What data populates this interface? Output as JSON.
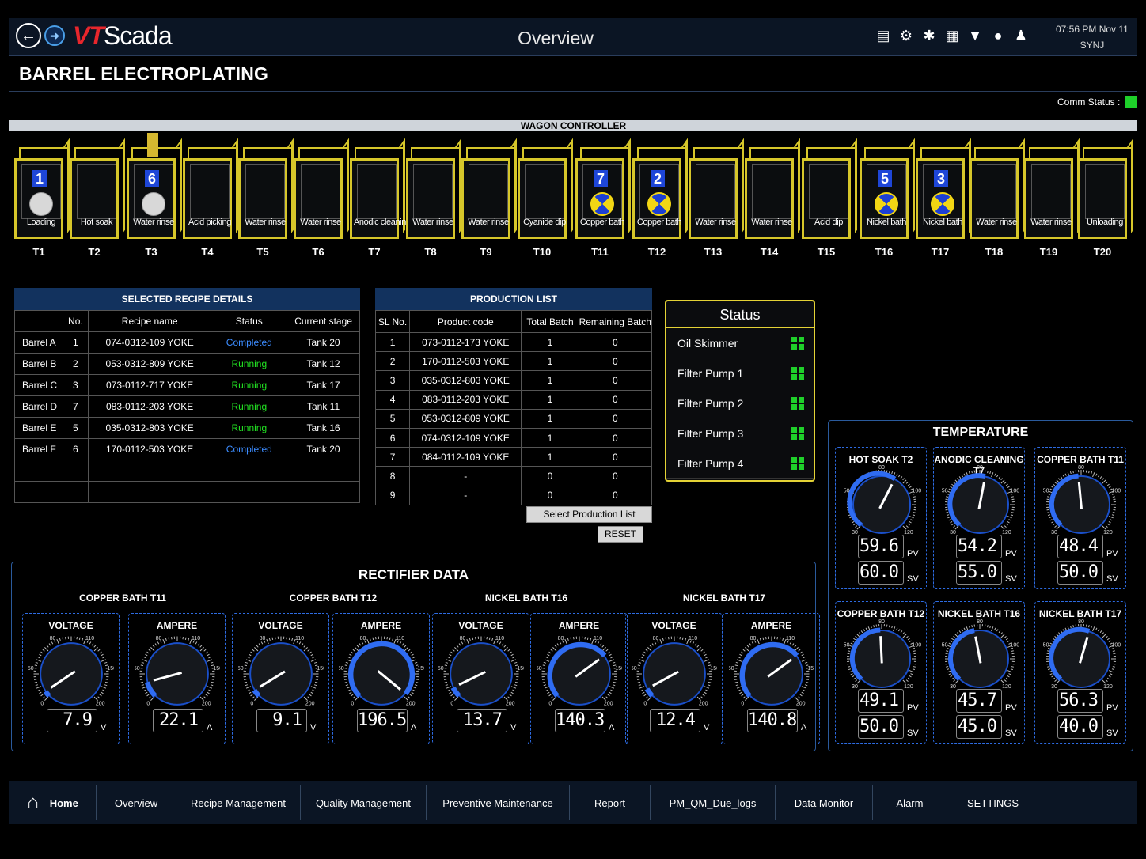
{
  "topbar": {
    "logo_vt": "VT",
    "logo_rest": "Scada",
    "title": "Overview",
    "time": "07:56 PM  Nov 11",
    "user": "SYNJ",
    "icons": [
      "trend-icon",
      "gear-icon",
      "maintenance-icon",
      "calendar-icon",
      "filter-icon",
      "help-icon",
      "user-icon"
    ]
  },
  "page_heading": "BARREL ELECTROPLATING",
  "comm_status_label": "Comm Status :",
  "wagon_controller_label": "WAGON CONTROLLER",
  "tanks": [
    {
      "id": "T1",
      "label": "Loading",
      "barrel": "1",
      "content": "white"
    },
    {
      "id": "T2",
      "label": "Hot soak",
      "barrel": "",
      "content": ""
    },
    {
      "id": "T3",
      "label": "Water rinse",
      "barrel": "6",
      "content": "white",
      "hoist": true
    },
    {
      "id": "T4",
      "label": "Acid picking",
      "barrel": "",
      "content": ""
    },
    {
      "id": "T5",
      "label": "Water rinse",
      "barrel": "",
      "content": ""
    },
    {
      "id": "T6",
      "label": "Water rinse",
      "barrel": "",
      "content": ""
    },
    {
      "id": "T7",
      "label": "Anodic cleaning",
      "barrel": "",
      "content": ""
    },
    {
      "id": "T8",
      "label": "Water rinse",
      "barrel": "",
      "content": ""
    },
    {
      "id": "T9",
      "label": "Water rinse",
      "barrel": "",
      "content": ""
    },
    {
      "id": "T10",
      "label": "Cyanide dip",
      "barrel": "",
      "content": ""
    },
    {
      "id": "T11",
      "label": "Copper bath",
      "barrel": "7",
      "content": "radial"
    },
    {
      "id": "T12",
      "label": "Copper bath",
      "barrel": "2",
      "content": "radial"
    },
    {
      "id": "T13",
      "label": "Water rinse",
      "barrel": "",
      "content": ""
    },
    {
      "id": "T14",
      "label": "Water rinse",
      "barrel": "",
      "content": ""
    },
    {
      "id": "T15",
      "label": "Acid dip",
      "barrel": "",
      "content": ""
    },
    {
      "id": "T16",
      "label": "Nickel bath",
      "barrel": "5",
      "content": "radial"
    },
    {
      "id": "T17",
      "label": "Nickel bath",
      "barrel": "3",
      "content": "radial"
    },
    {
      "id": "T18",
      "label": "Water rinse",
      "barrel": "",
      "content": ""
    },
    {
      "id": "T19",
      "label": "Water rinse",
      "barrel": "",
      "content": ""
    },
    {
      "id": "T20",
      "label": "Unloading",
      "barrel": "",
      "content": ""
    }
  ],
  "recipe": {
    "title": "SELECTED RECIPE DETAILS",
    "headers": [
      "",
      "No.",
      "Recipe name",
      "Status",
      "Current stage"
    ],
    "rows": [
      [
        "Barrel A",
        "1",
        "074-0312-109 YOKE",
        "Completed",
        "Tank 20"
      ],
      [
        "Barrel B",
        "2",
        "053-0312-809 YOKE",
        "Running",
        "Tank 12"
      ],
      [
        "Barrel C",
        "3",
        "073-0112-717 YOKE",
        "Running",
        "Tank 17"
      ],
      [
        "Barrel D",
        "7",
        "083-0112-203 YOKE",
        "Running",
        "Tank 11"
      ],
      [
        "Barrel E",
        "5",
        "035-0312-803 YOKE",
        "Running",
        "Tank 16"
      ],
      [
        "Barrel F",
        "6",
        "170-0112-503 YOKE",
        "Completed",
        "Tank 20"
      ],
      [
        "",
        "",
        "",
        "",
        ""
      ],
      [
        "",
        "",
        "",
        "",
        ""
      ]
    ]
  },
  "production": {
    "title": "PRODUCTION LIST",
    "headers": [
      "SL No.",
      "Product code",
      "Total Batch",
      "Remaining Batch"
    ],
    "rows": [
      [
        "1",
        "073-0112-173 YOKE",
        "1",
        "0"
      ],
      [
        "2",
        "170-0112-503 YOKE",
        "1",
        "0"
      ],
      [
        "3",
        "035-0312-803 YOKE",
        "1",
        "0"
      ],
      [
        "4",
        "083-0112-203 YOKE",
        "1",
        "0"
      ],
      [
        "5",
        "053-0312-809 YOKE",
        "1",
        "0"
      ],
      [
        "6",
        "074-0312-109 YOKE",
        "1",
        "0"
      ],
      [
        "7",
        "084-0112-109 YOKE",
        "1",
        "0"
      ],
      [
        "8",
        "-",
        "0",
        "0"
      ],
      [
        "9",
        "-",
        "0",
        "0"
      ]
    ],
    "select_button": "Select Production List",
    "reset_button": "RESET"
  },
  "status": {
    "title": "Status",
    "items": [
      "Oil Skimmer",
      "Filter Pump 1",
      "Filter Pump 2",
      "Filter Pump 3",
      "Filter Pump 4"
    ]
  },
  "rectifier": {
    "title": "RECTIFIER DATA",
    "groups": [
      "COPPER BATH T11",
      "COPPER BATH T12",
      "NICKEL BATH T16",
      "NICKEL BATH T17"
    ],
    "gauges": [
      {
        "label": "VOLTAGE",
        "value": "7.9",
        "unit": "V",
        "level": 0.04
      },
      {
        "label": "AMPERE",
        "value": "22.1",
        "unit": "A",
        "level": 0.11
      },
      {
        "label": "VOLTAGE",
        "value": "9.1",
        "unit": "V",
        "level": 0.05
      },
      {
        "label": "AMPERE",
        "value": "196.5",
        "unit": "A",
        "level": 0.98
      },
      {
        "label": "VOLTAGE",
        "value": "13.7",
        "unit": "V",
        "level": 0.07
      },
      {
        "label": "AMPERE",
        "value": "140.3",
        "unit": "A",
        "level": 0.7
      },
      {
        "label": "VOLTAGE",
        "value": "12.4",
        "unit": "V",
        "level": 0.06
      },
      {
        "label": "AMPERE",
        "value": "140.8",
        "unit": "A",
        "level": 0.7
      }
    ],
    "scale_ticks": [
      "0",
      "50",
      "80",
      "110",
      "150",
      "200"
    ]
  },
  "temperature": {
    "title": "TEMPERATURE",
    "pv_label": "PV",
    "sv_label": "SV",
    "gauges": [
      {
        "label": "HOT SOAK T2",
        "pv": "59.6",
        "sv": "60.0",
        "level": 0.6
      },
      {
        "label": "ANODIC CLEANING T7",
        "pv": "54.2",
        "sv": "55.0",
        "level": 0.54
      },
      {
        "label": "COPPER BATH T11",
        "pv": "48.4",
        "sv": "50.0",
        "level": 0.48
      },
      {
        "label": "COPPER BATH T12",
        "pv": "49.1",
        "sv": "50.0",
        "level": 0.49
      },
      {
        "label": "NICKEL BATH T16",
        "pv": "45.7",
        "sv": "45.0",
        "level": 0.46
      },
      {
        "label": "NICKEL BATH T17",
        "pv": "56.3",
        "sv": "40.0",
        "level": 0.56
      }
    ]
  },
  "bottom_nav": [
    "Home",
    "Overview",
    "Recipe Management",
    "Quality Management",
    "Preventive Maintenance",
    "Report",
    "PM_QM_Due_logs",
    "Data Monitor",
    "Alarm",
    "SETTINGS"
  ]
}
